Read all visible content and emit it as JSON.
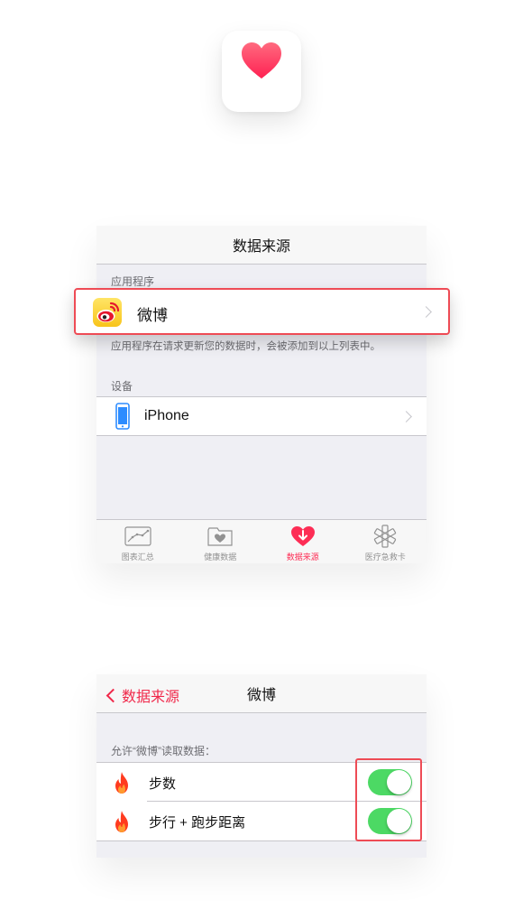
{
  "app_icon": {
    "name": "heart-icon",
    "color": "#ff2d55"
  },
  "sources_screen": {
    "title": "数据来源",
    "apps_header": "应用程序",
    "apps": [
      {
        "label": "微博",
        "icon": "weibo-icon"
      }
    ],
    "apps_footer": "应用程序在请求更新您的数据时，会被添加到以上列表中。",
    "devices_header": "设备",
    "devices": [
      {
        "label": "iPhone",
        "icon": "iphone-icon"
      }
    ],
    "tabs": [
      {
        "label": "图表汇总",
        "icon": "chart-icon",
        "active": false
      },
      {
        "label": "健康数据",
        "icon": "health-folder-icon",
        "active": false
      },
      {
        "label": "数据来源",
        "icon": "sources-heart-icon",
        "active": true
      },
      {
        "label": "医疗急救卡",
        "icon": "medical-id-icon",
        "active": false
      }
    ]
  },
  "weibo_screen": {
    "back_label": "数据来源",
    "title": "微博",
    "allow_header": "允许“微博”读取数据：",
    "permissions": [
      {
        "label": "步数",
        "icon": "flame-icon",
        "enabled": true
      },
      {
        "label": "步行 + 跑步距离",
        "icon": "flame-icon",
        "enabled": true
      }
    ]
  },
  "colors": {
    "accent": "#ff2d55",
    "toggle_on": "#4cd964",
    "highlight": "#ee4b55",
    "flame": "#ff3b1f"
  }
}
